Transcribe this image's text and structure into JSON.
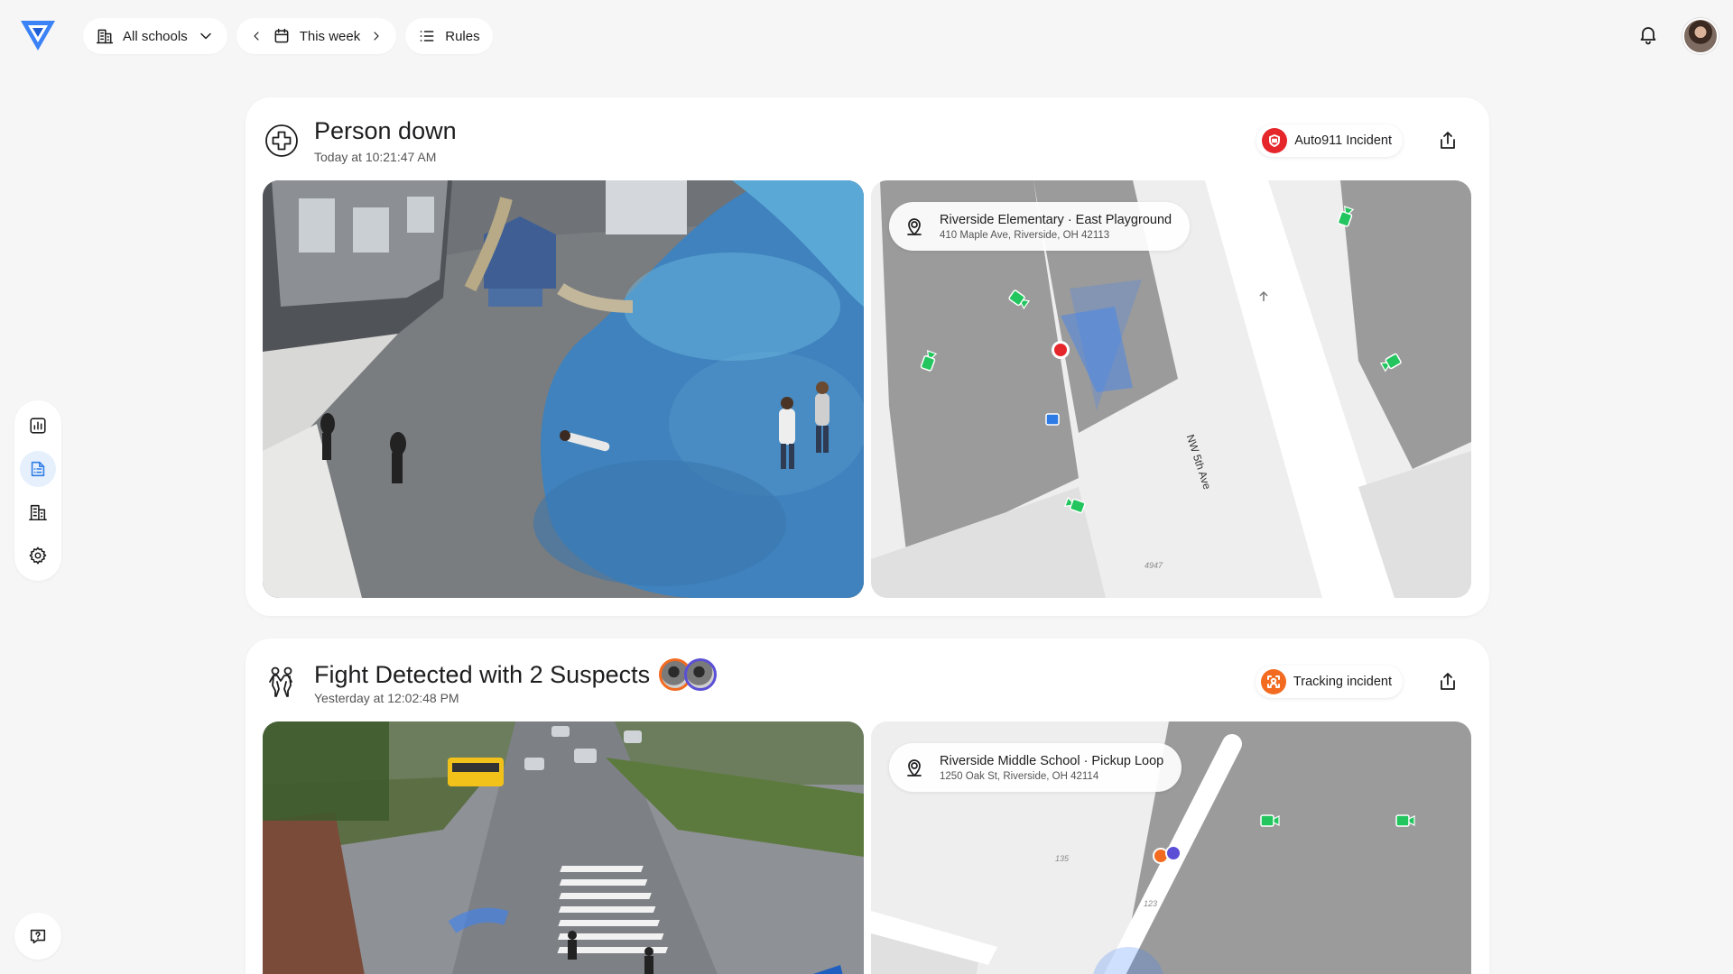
{
  "toolbar": {
    "schools_label": "All schools",
    "date_label": "This week",
    "rules_label": "Rules"
  },
  "incidents": [
    {
      "title": "Person down",
      "time": "Today at 10:21:47 AM",
      "badge": "Auto911 Incident",
      "badge_color": "#e5262b",
      "location": {
        "name": "Riverside Elementary · East Playground",
        "address": "410 Maple Ave, Riverside, OH 42113"
      },
      "map_labels": {
        "street": "NW 5th Ave",
        "parcel": "4947"
      }
    },
    {
      "title": "Fight Detected with 2 Suspects",
      "time": "Yesterday at 12:02:48 PM",
      "badge": "Tracking incident",
      "badge_color": "#f26b21",
      "suspect_colors": [
        "#f26b21",
        "#5b4fd6"
      ],
      "location": {
        "name": "Riverside Middle School · Pickup Loop",
        "address": "1250 Oak St, Riverside, OH 42114"
      },
      "map_labels": {
        "parcel_a": "135",
        "parcel_b": "123"
      }
    }
  ],
  "colors": {
    "camera_green": "#22c55e",
    "active_nav": "#2f7be5",
    "incident_red": "#e5262b"
  }
}
